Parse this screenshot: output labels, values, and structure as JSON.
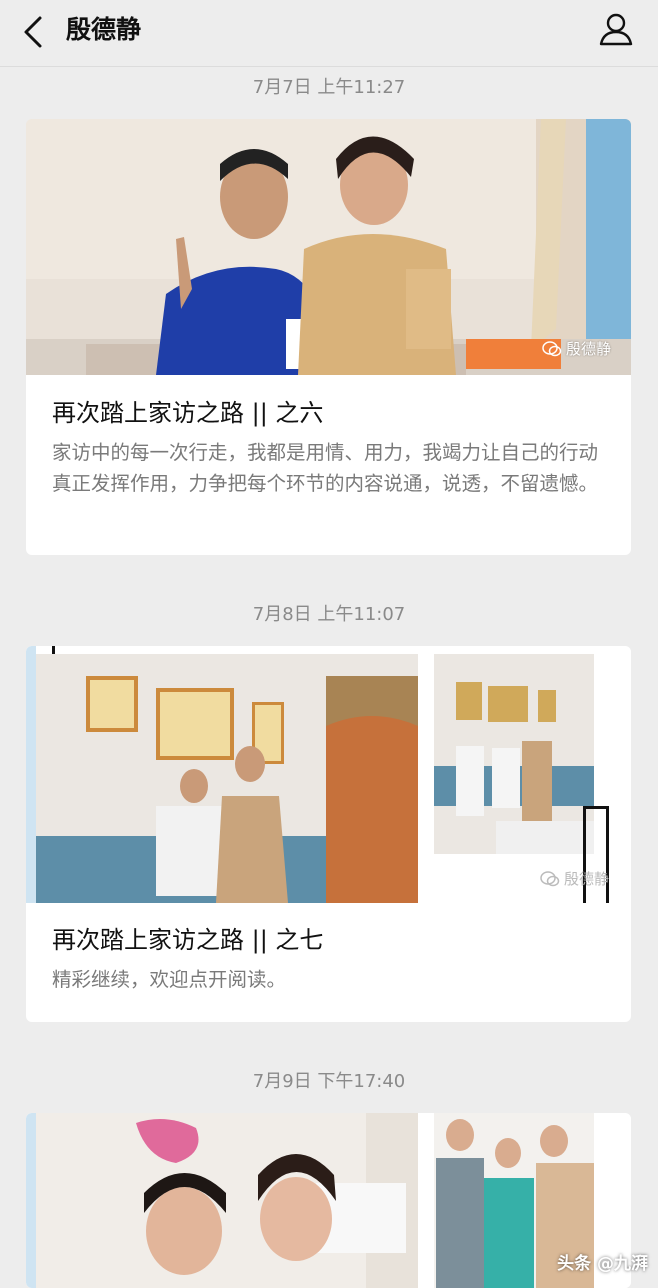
{
  "header": {
    "title": "殷德静"
  },
  "messages": [
    {
      "timestamp": "7月7日 上午11:27",
      "title": "再次踏上家访之路 || 之六",
      "description": "家访中的每一次行走，我都是用情、用力，我竭力让自己的行动真正发挥作用，力争把每个环节的内容说通，说透，不留遗憾。",
      "watermark": "殷德静"
    },
    {
      "timestamp": "7月8日 上午11:07",
      "title": "再次踏上家访之路 || 之七",
      "description": "精彩继续，欢迎点开阅读。",
      "watermark": "殷德静"
    },
    {
      "timestamp": "7月9日 下午17:40"
    }
  ],
  "corner_watermark": "头条 @九湃",
  "colors": {
    "background": "#ededed",
    "card": "#ffffff",
    "timestamp": "#8a8a8a",
    "description": "#7a7a7a"
  }
}
